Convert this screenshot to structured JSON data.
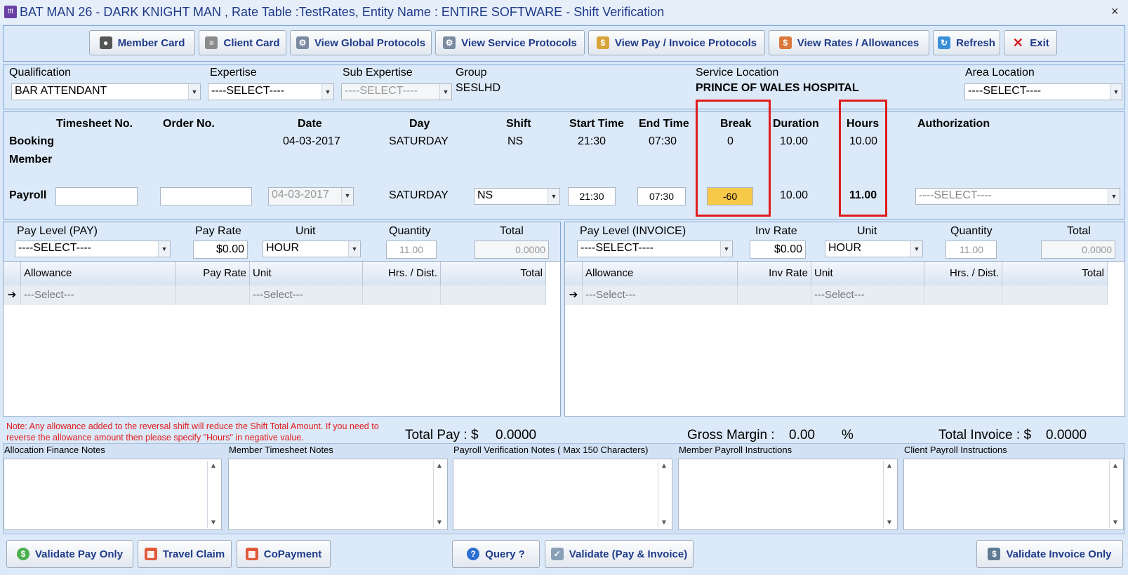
{
  "window": {
    "title": "BAT MAN 26 - DARK KNIGHT MAN , Rate Table :TestRates, Entity Name : ENTIRE SOFTWARE - Shift Verification",
    "close": "×"
  },
  "toolbar": {
    "member_card": "Member Card",
    "client_card": "Client Card",
    "view_global": "View Global Protocols",
    "view_service": "View Service Protocols",
    "view_payinv": "View Pay / Invoice Protocols",
    "view_rates": "View Rates / Allowances",
    "refresh": "Refresh",
    "exit": "Exit"
  },
  "filters": {
    "qualification_label": "Qualification",
    "qualification_value": "BAR ATTENDANT",
    "expertise_label": "Expertise",
    "expertise_value": "----SELECT----",
    "subexpertise_label": "Sub Expertise",
    "subexpertise_value": "----SELECT----",
    "group_label": "Group",
    "group_value": "SESLHD",
    "service_location_label": "Service Location",
    "service_location_value": "PRINCE OF WALES HOSPITAL",
    "area_location_label": "Area Location",
    "area_location_value": "----SELECT----"
  },
  "shift": {
    "headers": {
      "timesheet": "Timesheet No.",
      "order": "Order No.",
      "date": "Date",
      "day": "Day",
      "shift": "Shift",
      "start": "Start Time",
      "end": "End Time",
      "break": "Break",
      "duration": "Duration",
      "hours": "Hours",
      "auth": "Authorization"
    },
    "rows": {
      "booking": "Booking",
      "member": "Member",
      "payroll": "Payroll"
    },
    "booking": {
      "date": "04-03-2017",
      "day": "SATURDAY",
      "shift": "NS",
      "start": "21:30",
      "end": "07:30",
      "break": "0",
      "duration": "10.00",
      "hours": "10.00"
    },
    "payroll": {
      "timesheet": "",
      "order": "",
      "date": "04-03-2017",
      "day": "SATURDAY",
      "shift": "NS",
      "start": "21:30",
      "end": "07:30",
      "break": "-60",
      "duration": "10.00",
      "hours": "11.00",
      "auth": "----SELECT----"
    }
  },
  "pay": {
    "level_label": "Pay Level (PAY)",
    "level_value": "----SELECT----",
    "rate_label": "Pay Rate",
    "rate_value": "$0.00",
    "unit_label": "Unit",
    "unit_value": "HOUR",
    "qty_label": "Quantity",
    "qty_value": "11.00",
    "total_label": "Total",
    "total_value": "0.0000",
    "grid_headers": [
      "Allowance",
      "Pay Rate",
      "Unit",
      "Hrs. / Dist.",
      "Total"
    ],
    "grid_row": [
      "---Select---",
      "",
      "---Select---",
      "",
      ""
    ]
  },
  "invoice": {
    "level_label": "Pay Level (INVOICE)",
    "level_value": "----SELECT----",
    "rate_label": "Inv Rate",
    "rate_value": "$0.00",
    "unit_label": "Unit",
    "unit_value": "HOUR",
    "qty_label": "Quantity",
    "qty_value": "11.00",
    "total_label": "Total",
    "total_value": "0.0000",
    "grid_headers": [
      "Allowance",
      "Inv Rate",
      "Unit",
      "Hrs. / Dist.",
      "Total"
    ],
    "grid_row": [
      "---Select---",
      "",
      "---Select---",
      "",
      ""
    ]
  },
  "summary": {
    "note": "Note: Any allowance added to the reversal shift will reduce the Shift Total Amount. If you need to reverse the allowance amount then please specify \"Hours\" in negative value.",
    "total_pay_label": "Total Pay : $",
    "total_pay_value": "0.0000",
    "gross_margin_label": "Gross Margin :",
    "gross_margin_value": "0.00",
    "gross_margin_unit": "%",
    "total_invoice_label": "Total Invoice : $",
    "total_invoice_value": "0.0000"
  },
  "notes": {
    "allocation": "Allocation Finance Notes",
    "member_ts": "Member Timesheet Notes",
    "payroll_ver": "Payroll Verification Notes ( Max 150 Characters)",
    "member_payroll": "Member Payroll Instructions",
    "client_payroll": "Client Payroll Instructions"
  },
  "bottom": {
    "validate_pay": "Validate Pay Only",
    "travel": "Travel Claim",
    "copay": "CoPayment",
    "query": "Query ?",
    "validate_both": "Validate (Pay & Invoice)",
    "validate_inv": "Validate Invoice Only"
  },
  "colors": {
    "accent": "#1f3b8a",
    "highlight": "#f7c948",
    "annotation": "#e01b1b",
    "note_text": "#e01b1b"
  }
}
